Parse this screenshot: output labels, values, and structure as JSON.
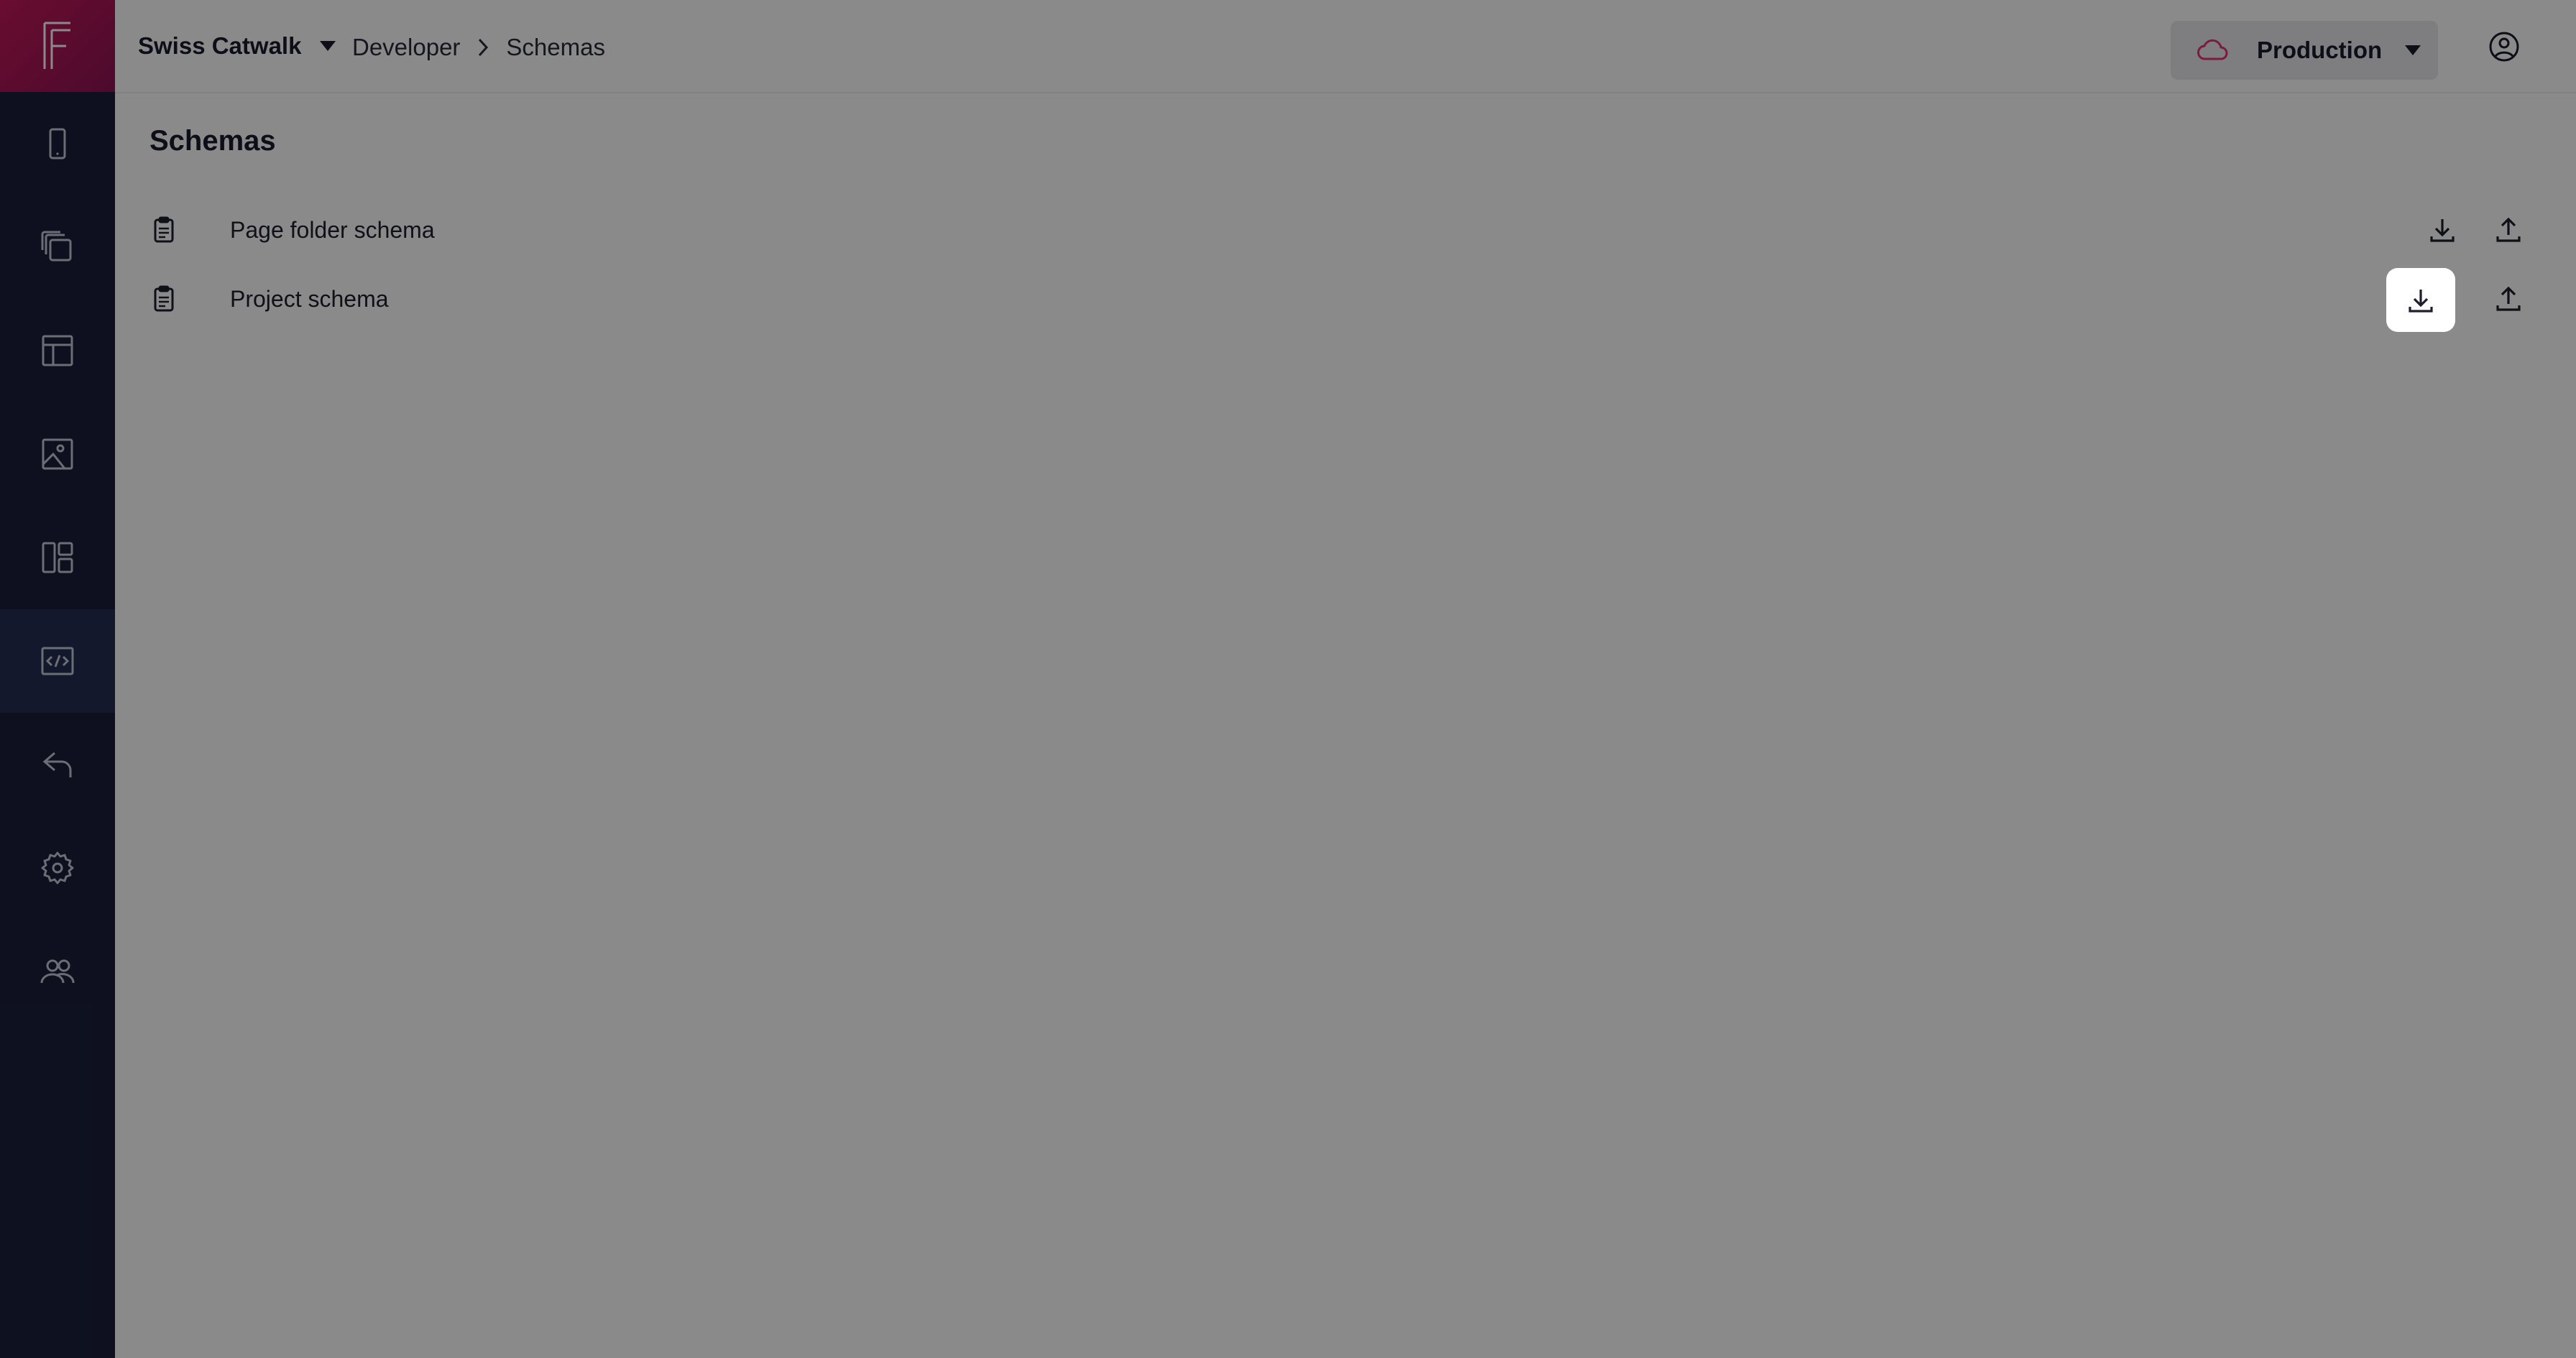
{
  "header": {
    "project_name": "Swiss Catwalk",
    "breadcrumb": [
      "Developer",
      "Schemas"
    ],
    "environment": "Production"
  },
  "sidebar": {
    "items": [
      {
        "icon": "mobile-device-icon"
      },
      {
        "icon": "copy-pages-icon"
      },
      {
        "icon": "layout-template-icon"
      },
      {
        "icon": "media-image-icon"
      },
      {
        "icon": "dashboard-widgets-icon"
      },
      {
        "icon": "code-developer-icon",
        "active": true
      },
      {
        "icon": "reply-back-icon"
      },
      {
        "icon": "settings-gear-icon"
      },
      {
        "icon": "users-group-icon"
      }
    ]
  },
  "main": {
    "title": "Schemas",
    "schemas": [
      {
        "label": "Page folder schema"
      },
      {
        "label": "Project schema"
      }
    ]
  },
  "colors": {
    "accent": "#e2346b",
    "sidebar_bg": "#1a1f3a",
    "cloud_icon": "#e2346b",
    "overlay": "rgba(0,0,0,0.46)"
  }
}
